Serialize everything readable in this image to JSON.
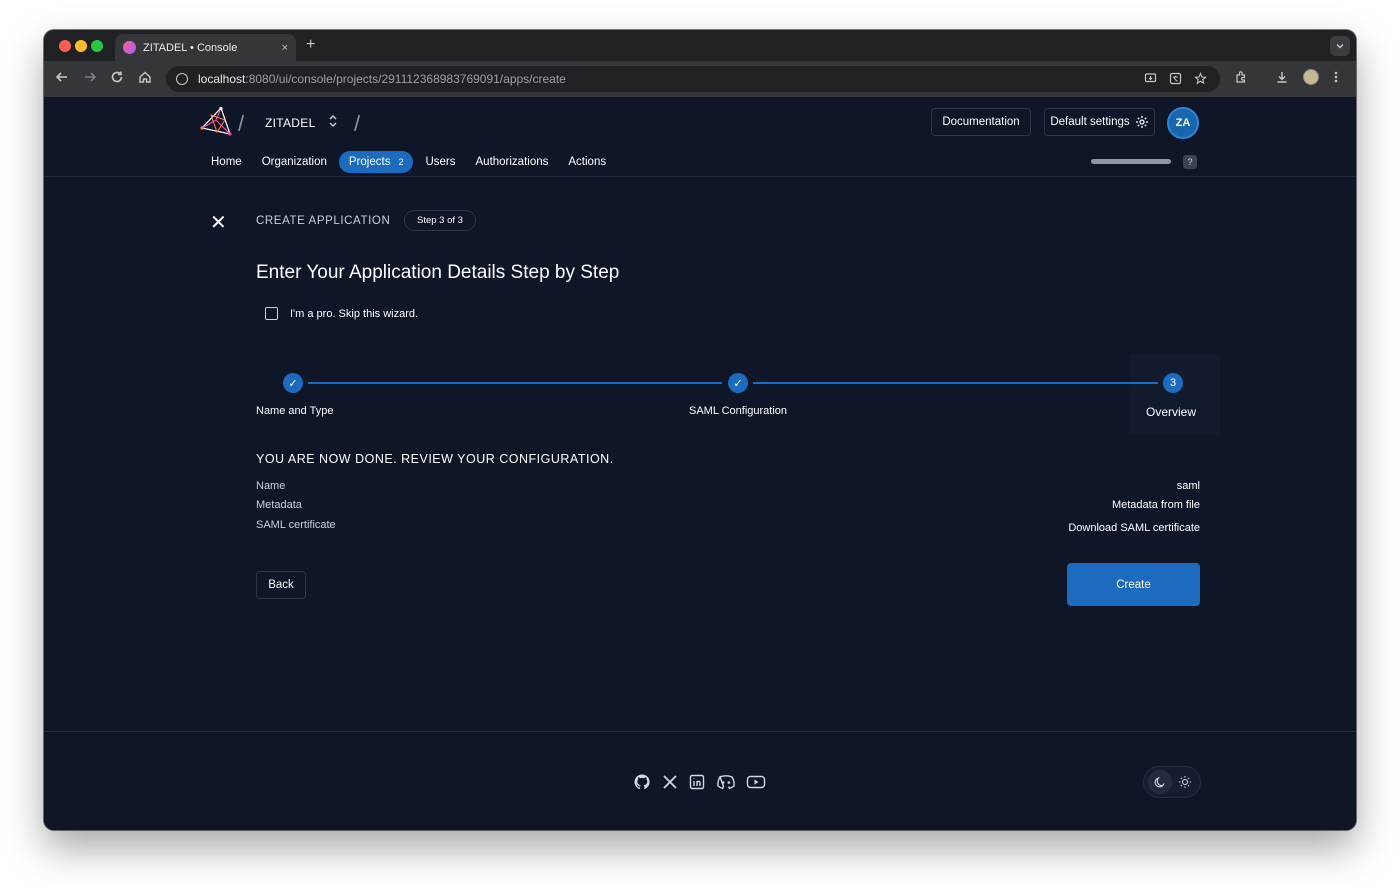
{
  "browser": {
    "tab_title": "ZITADEL • Console",
    "tab_close": "×",
    "new_tab": "+",
    "url_host": "localhost",
    "url_path": ":8080/ui/console/projects/291112368983769091/apps/create"
  },
  "header": {
    "org_name": "ZITADEL",
    "documentation_label": "Documentation",
    "settings_label": "Default settings",
    "avatar_initials": "ZA",
    "help_label": "?",
    "nav": [
      {
        "label": "Home"
      },
      {
        "label": "Organization"
      },
      {
        "label": "Projects",
        "badge": "2"
      },
      {
        "label": "Users"
      },
      {
        "label": "Authorizations"
      },
      {
        "label": "Actions"
      }
    ]
  },
  "wizard": {
    "close_icon": "✕",
    "title": "CREATE APPLICATION",
    "step_chip": "Step 3 of 3",
    "heading": "Enter Your Application Details Step by Step",
    "skip_label": "I'm a pro. Skip this wizard.",
    "steps": [
      {
        "label": "Name and Type",
        "state": "done",
        "mark": "✓"
      },
      {
        "label": "SAML Configuration",
        "state": "done",
        "mark": "✓"
      },
      {
        "label": "Overview",
        "state": "active",
        "mark": "3"
      }
    ],
    "done_heading": "YOU ARE NOW DONE. REVIEW YOUR CONFIGURATION.",
    "review": [
      {
        "key": "Name",
        "value": "saml"
      },
      {
        "key": "Metadata",
        "value": "Metadata from file"
      },
      {
        "key": "SAML certificate",
        "value": "Download SAML certificate"
      }
    ],
    "back_label": "Back",
    "create_label": "Create"
  },
  "colors": {
    "background": "#0f1628",
    "accent": "#1c6bbf"
  },
  "footer": {
    "social_icons": [
      "github-icon",
      "x-icon",
      "linkedin-icon",
      "discord-icon",
      "youtube-icon"
    ]
  }
}
